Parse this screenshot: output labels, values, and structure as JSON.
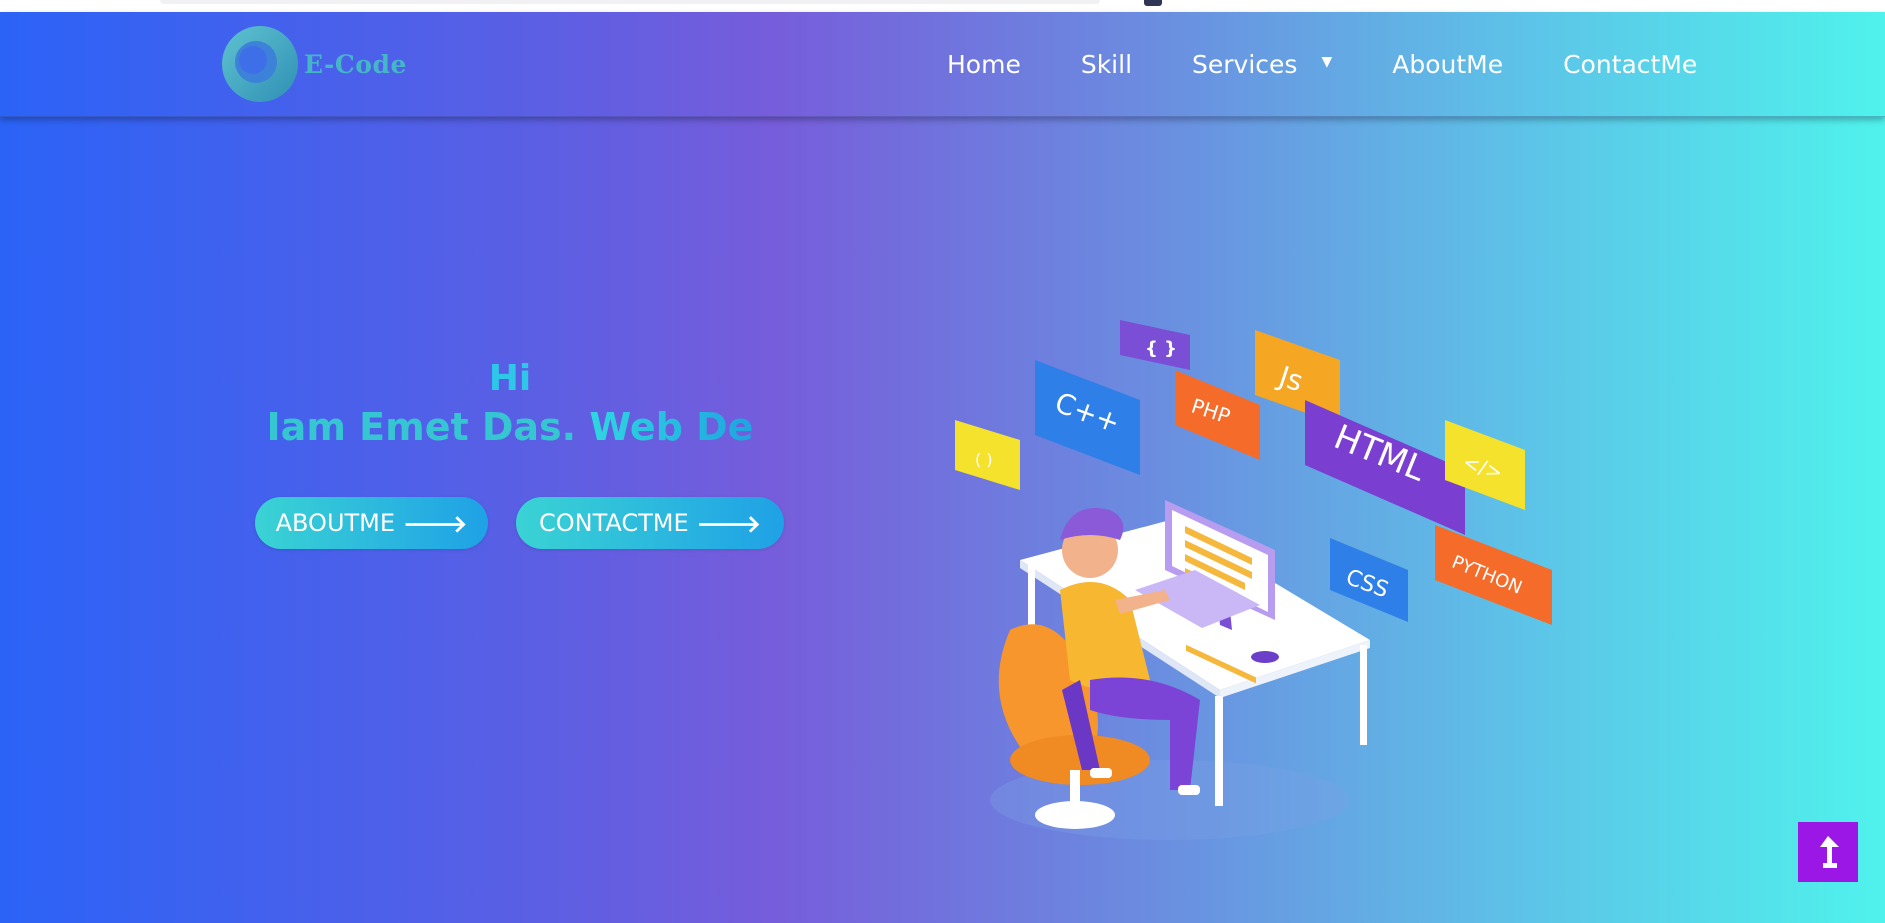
{
  "brand": {
    "logo_text": "E-Code",
    "logo_color": "#44b6c6"
  },
  "nav": {
    "items": [
      {
        "label": "Home"
      },
      {
        "label": "Skill"
      },
      {
        "label": "Services",
        "has_dropdown": true
      },
      {
        "label": "AboutMe"
      },
      {
        "label": "ContactMe"
      }
    ],
    "dropdown_caret": "▼"
  },
  "hero": {
    "greeting": "Hi",
    "intro": "Iam Emet Das.",
    "typed_role": "Web De",
    "buttons": [
      {
        "label": "ABOUTME",
        "icon": "arrow-right-icon"
      },
      {
        "label": "CONTACTME",
        "icon": "arrow-right-icon"
      }
    ],
    "illustration_tags": [
      "{ }",
      "C++",
      "PHP",
      "Js",
      "HTML",
      "</>",
      "( )",
      "CSS",
      "PYTHON"
    ]
  },
  "scroll_top": {
    "icon": "arrow-up-icon"
  },
  "colors": {
    "gradient_left": "#2b63f7",
    "gradient_mid": "#765ddb",
    "gradient_right": "#4ff2ec",
    "button": "#1fa1e6",
    "scroll_top_bg": "#9b17e6"
  }
}
